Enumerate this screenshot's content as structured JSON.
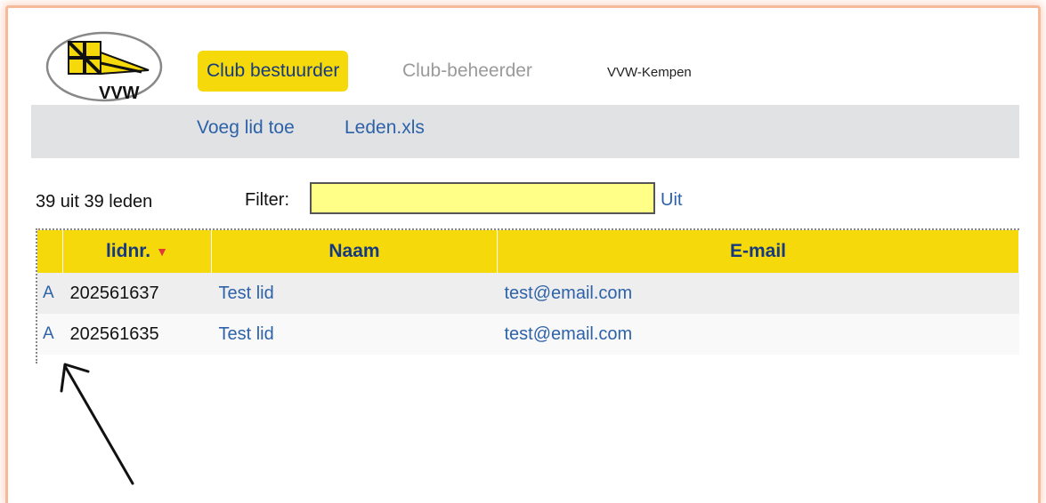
{
  "header": {
    "logo_text": "VVW",
    "nav": {
      "active": "Club bestuurder",
      "inactive": "Club-beheerder",
      "brand": "VVW-Kempen"
    }
  },
  "subnav": {
    "add_member": "Voeg lid toe",
    "export": "Leden.xls"
  },
  "toolbar": {
    "count_text": "39 uit 39 leden",
    "filter_label": "Filter:",
    "filter_value": "",
    "filter_off": "Uit"
  },
  "table": {
    "columns": [
      "lidnr.",
      "Naam",
      "E-mail"
    ],
    "sort_indicator": "▼",
    "rows": [
      {
        "action": "A",
        "id": "202561637",
        "name": "Test lid",
        "email": "test@email.com"
      },
      {
        "action": "A",
        "id": "202561635",
        "name": "Test lid",
        "email": "test@email.com"
      }
    ]
  },
  "colors": {
    "accent_yellow": "#f5d90a",
    "link_blue": "#2d62a9",
    "header_text": "#163a80",
    "sort_arrow": "#e03b3b",
    "filter_bg": "#ffff88",
    "frame_border": "#f6b99a"
  },
  "icons": {
    "logo": "vvw-flag-logo",
    "sort": "triangle-down-icon",
    "annotation": "arrow-up-left-icon"
  }
}
